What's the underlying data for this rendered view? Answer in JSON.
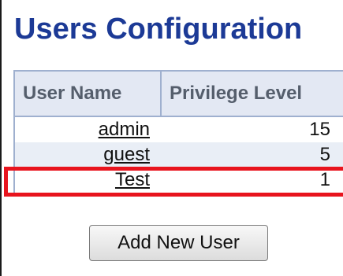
{
  "page": {
    "title": "Users Configuration"
  },
  "table": {
    "headers": {
      "user_name": "User Name",
      "privilege_level": "Privilege Level"
    },
    "rows": [
      {
        "user_name": "admin",
        "privilege_level": "15"
      },
      {
        "user_name": "guest",
        "privilege_level": "5"
      },
      {
        "user_name": "Test",
        "privilege_level": "1"
      }
    ]
  },
  "actions": {
    "add_new_user_label": "Add New User"
  },
  "colors": {
    "title": "#1c3a96",
    "header_bg": "#e3e8f3",
    "table_border": "#9fb0cf",
    "alt_row_bg": "#e9eef6",
    "highlight": "#e8141e"
  }
}
